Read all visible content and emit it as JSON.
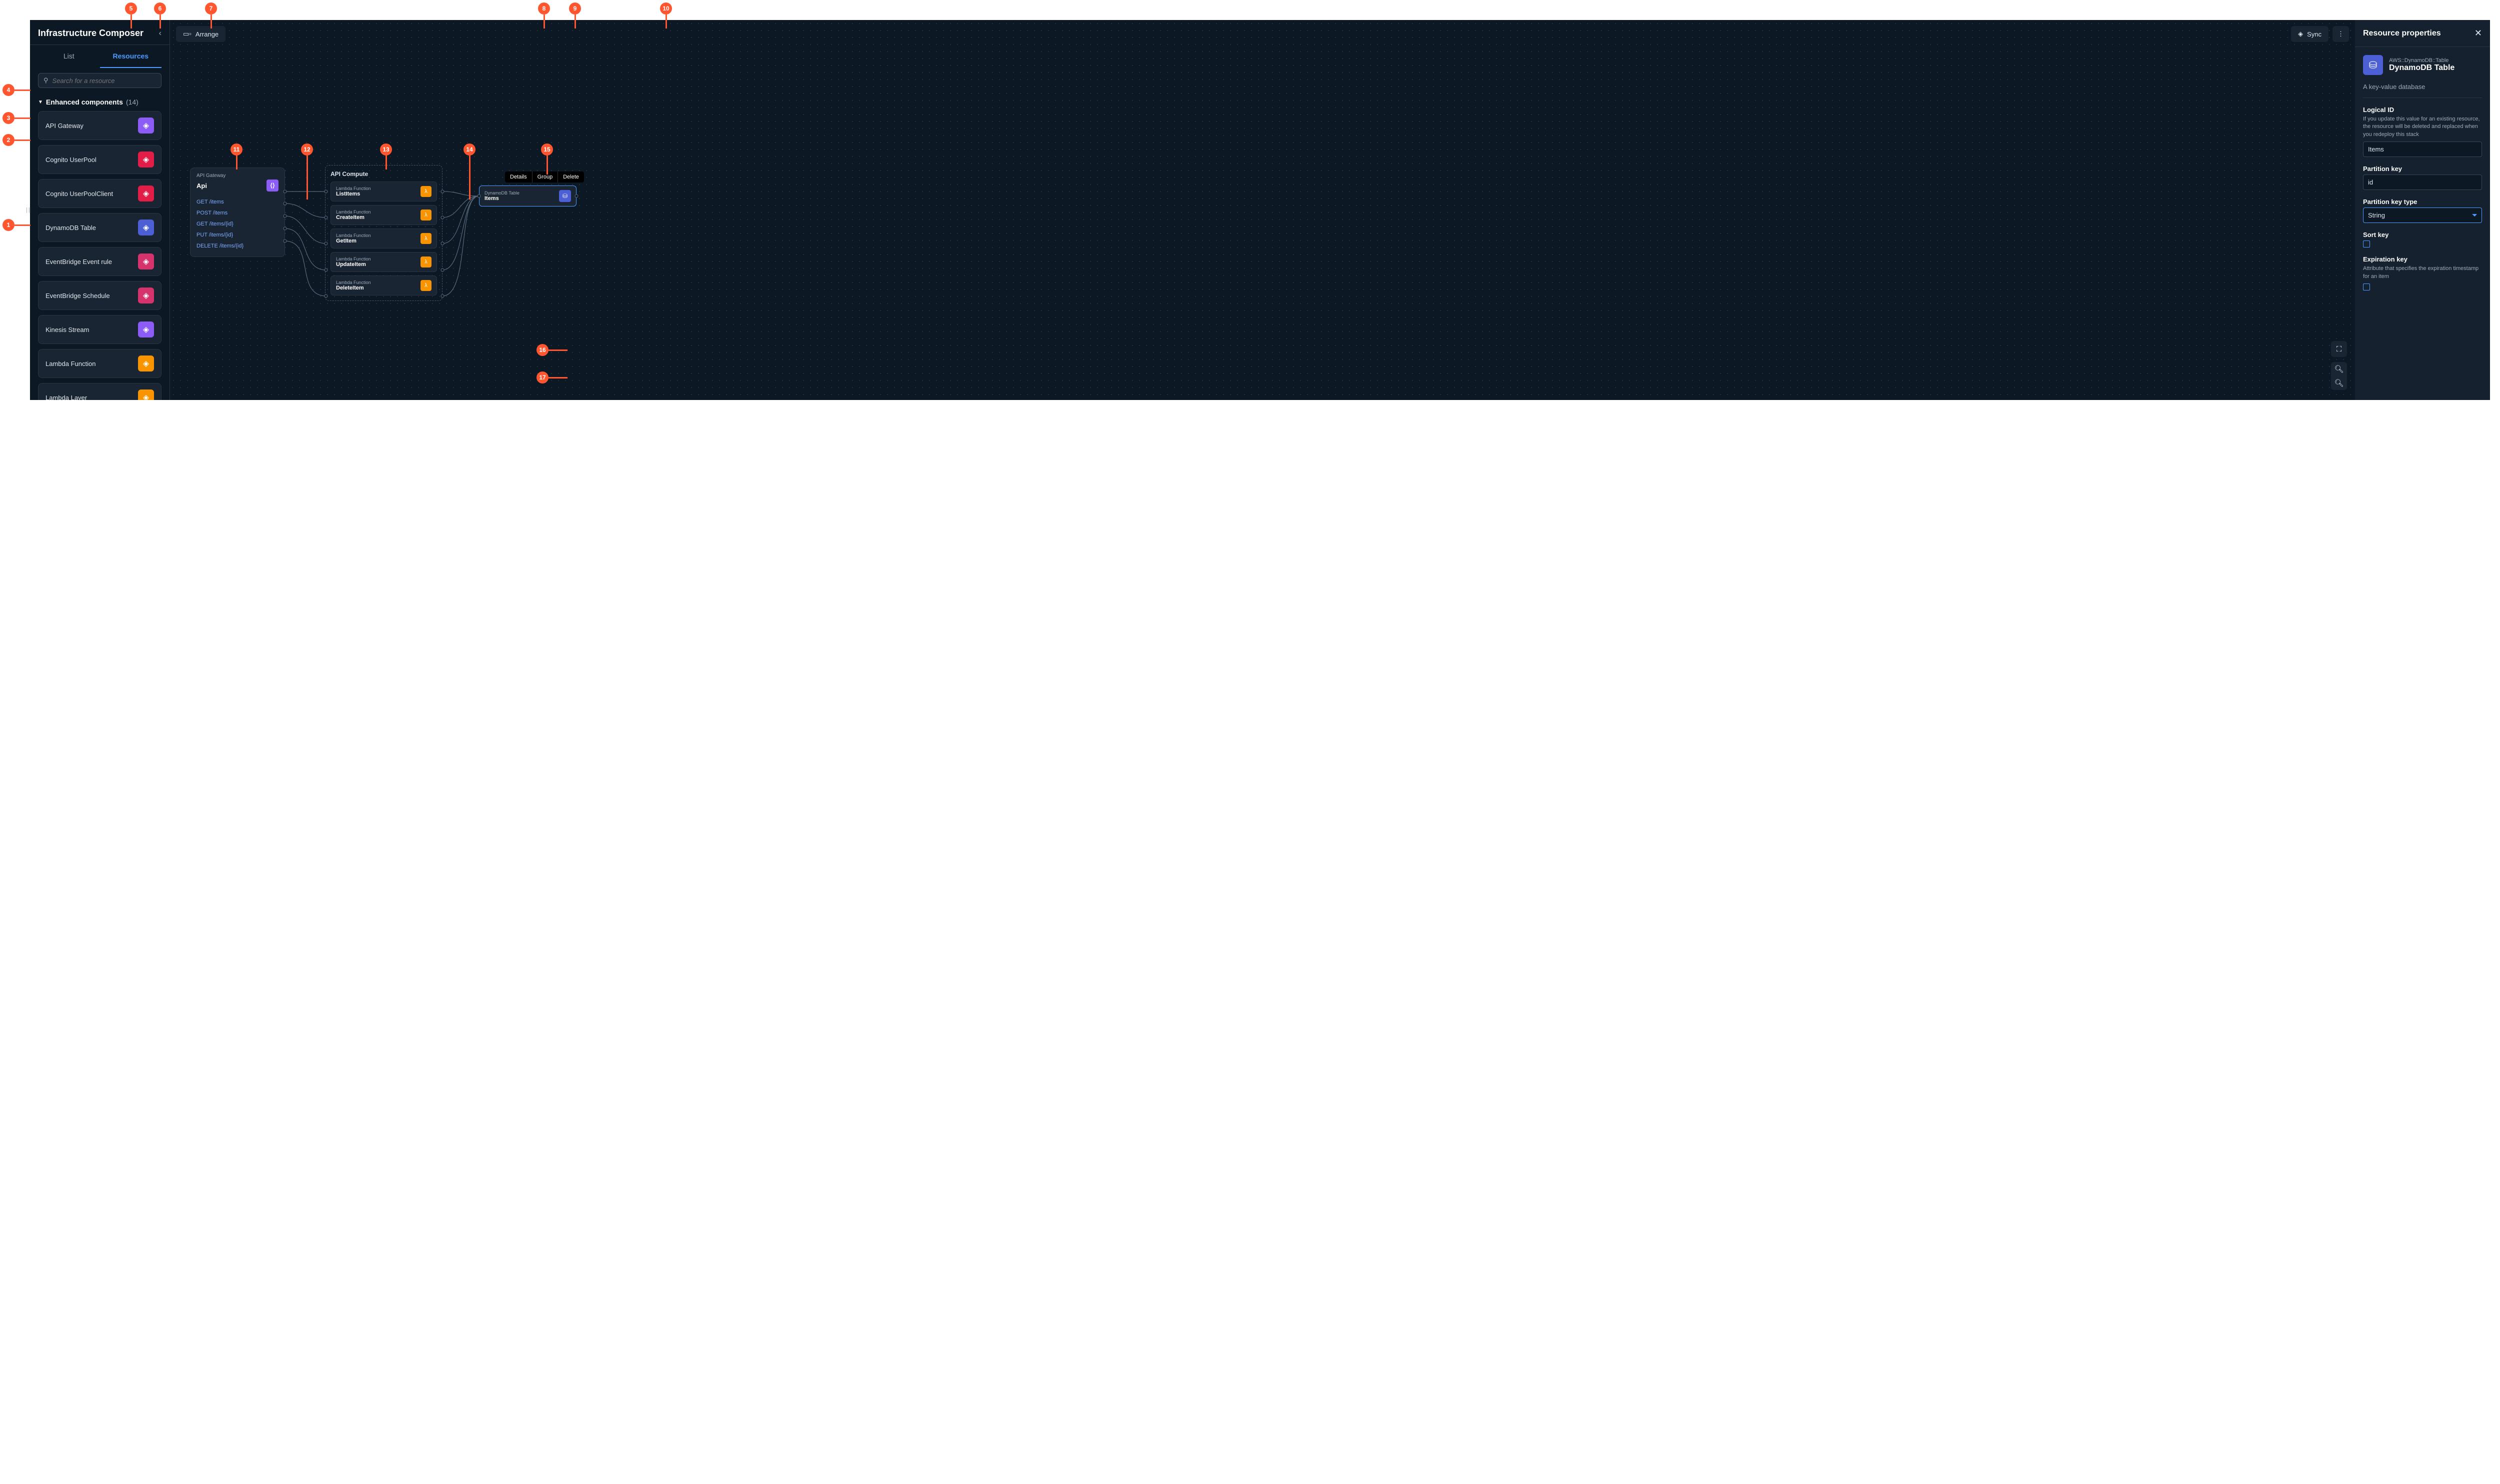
{
  "sidebar": {
    "title": "Infrastructure Composer",
    "tabs": {
      "list": "List",
      "resources": "Resources"
    },
    "search_placeholder": "Search for a resource",
    "section_title": "Enhanced components",
    "section_count": "(14)",
    "items": [
      {
        "label": "API Gateway",
        "color": "#8b5cf6"
      },
      {
        "label": "Cognito UserPool",
        "color": "#e11d48"
      },
      {
        "label": "Cognito UserPoolClient",
        "color": "#e11d48"
      },
      {
        "label": "DynamoDB Table",
        "color": "#4c5fd5"
      },
      {
        "label": "EventBridge Event rule",
        "color": "#d6336c"
      },
      {
        "label": "EventBridge Schedule",
        "color": "#d6336c"
      },
      {
        "label": "Kinesis Stream",
        "color": "#8b5cf6"
      },
      {
        "label": "Lambda Function",
        "color": "#f79400"
      },
      {
        "label": "Lambda Layer",
        "color": "#f79400"
      }
    ]
  },
  "canvas": {
    "arrange": "Arrange",
    "sync": "Sync",
    "api_node": {
      "type": "API Gateway",
      "name": "Api",
      "routes": [
        "GET /items",
        "POST /items",
        "GET /items/{id}",
        "PUT /items/{id}",
        "DELETE /items/{id}"
      ]
    },
    "group": {
      "title": "API Compute",
      "lambdas": [
        {
          "type": "Lambda Function",
          "name": "ListItems"
        },
        {
          "type": "Lambda Function",
          "name": "CreateItem"
        },
        {
          "type": "Lambda Function",
          "name": "GetItem"
        },
        {
          "type": "Lambda Function",
          "name": "UpdateItem"
        },
        {
          "type": "Lambda Function",
          "name": "DeleteItem"
        }
      ]
    },
    "ddb_node": {
      "type": "DynamoDB Table",
      "name": "Items"
    },
    "context_menu": [
      "Details",
      "Group",
      "Delete"
    ]
  },
  "props": {
    "title": "Resource properties",
    "res_type": "AWS::DynamoDB::Table",
    "res_name": "DynamoDB Table",
    "desc": "A key-value database",
    "fields": {
      "logical_id": {
        "label": "Logical ID",
        "hint": "If you update this value for an existing resource, the resource will be deleted and replaced when you redeploy this stack",
        "value": "Items"
      },
      "pk": {
        "label": "Partition key",
        "value": "id"
      },
      "pk_type": {
        "label": "Partition key type",
        "value": "String"
      },
      "sk": {
        "label": "Sort key"
      },
      "exp": {
        "label": "Expiration key",
        "hint": "Attribute that specifies the expiration timestamp for an item"
      }
    }
  },
  "callouts": [
    "1",
    "2",
    "3",
    "4",
    "5",
    "6",
    "7",
    "8",
    "9",
    "10",
    "11",
    "12",
    "13",
    "14",
    "15",
    "16",
    "17"
  ]
}
